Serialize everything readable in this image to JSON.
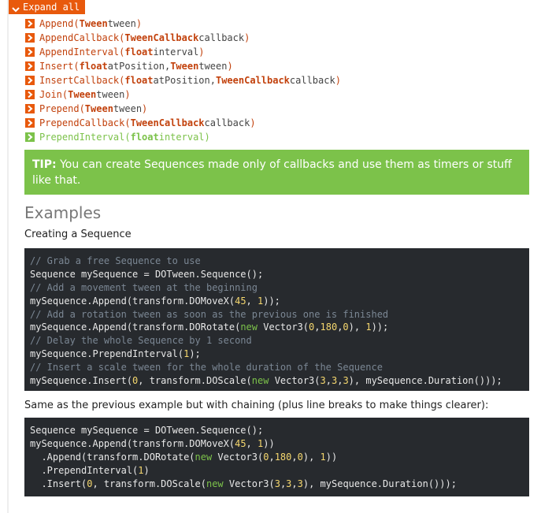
{
  "expand_all": {
    "label": "Expand all"
  },
  "methods": [
    {
      "name": "Append(",
      "params": [
        {
          "type": "Tween",
          "name": " tween"
        }
      ],
      "close": ")"
    },
    {
      "name": "AppendCallback(",
      "params": [
        {
          "type": "TweenCallback",
          "name": " callback"
        }
      ],
      "close": ")"
    },
    {
      "name": "AppendInterval(",
      "params": [
        {
          "type": "float",
          "name": " interval"
        }
      ],
      "close": ")"
    },
    {
      "name": "Insert(",
      "params": [
        {
          "type": "float",
          "name": " atPosition, "
        },
        {
          "type": "Tween",
          "name": " tween"
        }
      ],
      "close": ")"
    },
    {
      "name": "InsertCallback(",
      "params": [
        {
          "type": "float",
          "name": " atPosition, "
        },
        {
          "type": "TweenCallback",
          "name": " callback"
        }
      ],
      "close": ")"
    },
    {
      "name": "Join(",
      "params": [
        {
          "type": "Tween",
          "name": " tween"
        }
      ],
      "close": ")"
    },
    {
      "name": "Prepend(",
      "params": [
        {
          "type": "Tween",
          "name": " tween"
        }
      ],
      "close": ")"
    },
    {
      "name": "PrependCallback(",
      "params": [
        {
          "type": "TweenCallback",
          "name": " callback"
        }
      ],
      "close": ")"
    },
    {
      "name": "PrependInterval(",
      "params": [
        {
          "type": "float",
          "name": " interval"
        }
      ],
      "close": ")",
      "active": true
    }
  ],
  "tip": {
    "label": "TIP:",
    "text": " You can create Sequences made only of callbacks and use them as timers or stuff like that."
  },
  "examples": {
    "heading": "Examples",
    "example1_title": "Creating a Sequence",
    "example1_code": [
      [
        {
          "c": "comment",
          "t": "// Grab a free Sequence to use"
        }
      ],
      [
        {
          "c": "plain",
          "t": "Sequence mySequence = DOTween.Sequence();"
        }
      ],
      [
        {
          "c": "comment",
          "t": "// Add a movement tween at the beginning"
        }
      ],
      [
        {
          "c": "plain",
          "t": "mySequence.Append(transform.DOMoveX("
        },
        {
          "c": "num",
          "t": "45"
        },
        {
          "c": "plain",
          "t": ", "
        },
        {
          "c": "num",
          "t": "1"
        },
        {
          "c": "plain",
          "t": "));"
        }
      ],
      [
        {
          "c": "comment",
          "t": "// Add a rotation tween as soon as the previous one is finished"
        }
      ],
      [
        {
          "c": "plain",
          "t": "mySequence.Append(transform.DORotate("
        },
        {
          "c": "kw",
          "t": "new"
        },
        {
          "c": "plain",
          "t": " Vector3("
        },
        {
          "c": "num",
          "t": "0"
        },
        {
          "c": "plain",
          "t": ","
        },
        {
          "c": "num",
          "t": "180"
        },
        {
          "c": "plain",
          "t": ","
        },
        {
          "c": "num",
          "t": "0"
        },
        {
          "c": "plain",
          "t": "), "
        },
        {
          "c": "num",
          "t": "1"
        },
        {
          "c": "plain",
          "t": "));"
        }
      ],
      [
        {
          "c": "comment",
          "t": "// Delay the whole Sequence by 1 second"
        }
      ],
      [
        {
          "c": "plain",
          "t": "mySequence.PrependInterval("
        },
        {
          "c": "num",
          "t": "1"
        },
        {
          "c": "plain",
          "t": ");"
        }
      ],
      [
        {
          "c": "comment",
          "t": "// Insert a scale tween for the whole duration of the Sequence"
        }
      ],
      [
        {
          "c": "plain",
          "t": "mySequence.Insert("
        },
        {
          "c": "num",
          "t": "0"
        },
        {
          "c": "plain",
          "t": ", transform.DOScale("
        },
        {
          "c": "kw",
          "t": "new"
        },
        {
          "c": "plain",
          "t": " Vector3("
        },
        {
          "c": "num",
          "t": "3"
        },
        {
          "c": "plain",
          "t": ","
        },
        {
          "c": "num",
          "t": "3"
        },
        {
          "c": "plain",
          "t": ","
        },
        {
          "c": "num",
          "t": "3"
        },
        {
          "c": "plain",
          "t": "), mySequence.Duration()));"
        }
      ]
    ],
    "example2_title": "Same as the previous example but with chaining (plus line breaks to make things clearer):",
    "example2_code": [
      [
        {
          "c": "plain",
          "t": "Sequence mySequence = DOTween.Sequence();"
        }
      ],
      [
        {
          "c": "plain",
          "t": "mySequence.Append(transform.DOMoveX("
        },
        {
          "c": "num",
          "t": "45"
        },
        {
          "c": "plain",
          "t": ", "
        },
        {
          "c": "num",
          "t": "1"
        },
        {
          "c": "plain",
          "t": "))"
        }
      ],
      [
        {
          "c": "plain",
          "t": "  .Append(transform.DORotate("
        },
        {
          "c": "kw",
          "t": "new"
        },
        {
          "c": "plain",
          "t": " Vector3("
        },
        {
          "c": "num",
          "t": "0"
        },
        {
          "c": "plain",
          "t": ","
        },
        {
          "c": "num",
          "t": "180"
        },
        {
          "c": "plain",
          "t": ","
        },
        {
          "c": "num",
          "t": "0"
        },
        {
          "c": "plain",
          "t": "), "
        },
        {
          "c": "num",
          "t": "1"
        },
        {
          "c": "plain",
          "t": "))"
        }
      ],
      [
        {
          "c": "plain",
          "t": "  .PrependInterval("
        },
        {
          "c": "num",
          "t": "1"
        },
        {
          "c": "plain",
          "t": ")"
        }
      ],
      [
        {
          "c": "plain",
          "t": "  .Insert("
        },
        {
          "c": "num",
          "t": "0"
        },
        {
          "c": "plain",
          "t": ", transform.DOScale("
        },
        {
          "c": "kw",
          "t": "new"
        },
        {
          "c": "plain",
          "t": " Vector3("
        },
        {
          "c": "num",
          "t": "3"
        },
        {
          "c": "plain",
          "t": ","
        },
        {
          "c": "num",
          "t": "3"
        },
        {
          "c": "plain",
          "t": ","
        },
        {
          "c": "num",
          "t": "3"
        },
        {
          "c": "plain",
          "t": "), mySequence.Duration()));"
        }
      ]
    ]
  },
  "colors": {
    "accent": "#e8590c",
    "tip_green": "#7cc24a",
    "code_bg": "#272a2e"
  },
  "icons": {
    "expand": "chevron-down-icon",
    "item": "chevron-right-icon"
  }
}
